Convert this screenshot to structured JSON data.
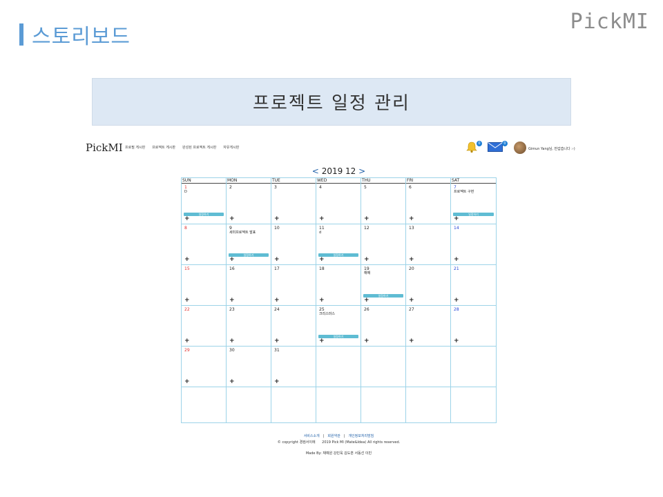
{
  "slide": {
    "title": "스토리보드",
    "logo": "PickMI",
    "subtitle": "프로젝트 일정 관리",
    "accent_color": "#5b9bd5"
  },
  "app": {
    "logo": "PickMI",
    "nav": [
      "프로필 게시판",
      "프로젝트 게시판",
      "완성된 프로젝트 게시판",
      "자유게시판"
    ],
    "notifications": {
      "bell_count": "0",
      "mail_count": "0"
    },
    "greeting": "Gimun Yang님, 반갑습니다 :-)",
    "icons": {
      "bell": "bell-icon",
      "mail": "mail-icon",
      "avatar": "avatar"
    }
  },
  "calendar": {
    "prev": "<",
    "title": "2019 12",
    "next": ">",
    "weekdays": [
      "SUN",
      "MON",
      "TUE",
      "WED",
      "THU",
      "FRI",
      "SAT"
    ],
    "event_button_label": "일정하기",
    "add_symbol": "+",
    "weeks": [
      [
        {
          "day": "1",
          "event": "D",
          "button": true,
          "add": true
        },
        {
          "day": "2",
          "event": "",
          "button": false,
          "add": true
        },
        {
          "day": "3",
          "event": "",
          "button": false,
          "add": true
        },
        {
          "day": "4",
          "event": "",
          "button": false,
          "add": true
        },
        {
          "day": "5",
          "event": "",
          "button": false,
          "add": true
        },
        {
          "day": "6",
          "event": "",
          "button": false,
          "add": true
        },
        {
          "day": "7",
          "event": "프로젝트 구현",
          "button": true,
          "add": true
        }
      ],
      [
        {
          "day": "8",
          "event": "",
          "button": false,
          "add": true
        },
        {
          "day": "9",
          "event": "세미프로젝트 발표",
          "button": true,
          "add": true
        },
        {
          "day": "10",
          "event": "",
          "button": false,
          "add": true
        },
        {
          "day": "11",
          "event": "d",
          "button": true,
          "add": true
        },
        {
          "day": "12",
          "event": "",
          "button": false,
          "add": true
        },
        {
          "day": "13",
          "event": "",
          "button": false,
          "add": true
        },
        {
          "day": "14",
          "event": "",
          "button": false,
          "add": true
        }
      ],
      [
        {
          "day": "15",
          "event": "",
          "button": false,
          "add": true
        },
        {
          "day": "16",
          "event": "",
          "button": false,
          "add": true
        },
        {
          "day": "17",
          "event": "",
          "button": false,
          "add": true
        },
        {
          "day": "18",
          "event": "",
          "button": false,
          "add": true
        },
        {
          "day": "19",
          "event": "해해",
          "button": true,
          "add": true
        },
        {
          "day": "20",
          "event": "",
          "button": false,
          "add": true
        },
        {
          "day": "21",
          "event": "",
          "button": false,
          "add": true
        }
      ],
      [
        {
          "day": "22",
          "event": "",
          "button": false,
          "add": true
        },
        {
          "day": "23",
          "event": "",
          "button": false,
          "add": true
        },
        {
          "day": "24",
          "event": "",
          "button": false,
          "add": true
        },
        {
          "day": "25",
          "event": "크리스마스",
          "button": true,
          "add": true
        },
        {
          "day": "26",
          "event": "",
          "button": false,
          "add": true
        },
        {
          "day": "27",
          "event": "",
          "button": false,
          "add": true
        },
        {
          "day": "28",
          "event": "",
          "button": false,
          "add": true
        }
      ],
      [
        {
          "day": "29",
          "event": "",
          "button": false,
          "add": true
        },
        {
          "day": "30",
          "event": "",
          "button": false,
          "add": true
        },
        {
          "day": "31",
          "event": "",
          "button": false,
          "add": true
        },
        {
          "day": "",
          "event": "",
          "button": false,
          "add": false
        },
        {
          "day": "",
          "event": "",
          "button": false,
          "add": false
        },
        {
          "day": "",
          "event": "",
          "button": false,
          "add": false
        },
        {
          "day": "",
          "event": "",
          "button": false,
          "add": false
        }
      ],
      [
        {
          "day": "",
          "event": "",
          "button": false,
          "add": false
        },
        {
          "day": "",
          "event": "",
          "button": false,
          "add": false
        },
        {
          "day": "",
          "event": "",
          "button": false,
          "add": false
        },
        {
          "day": "",
          "event": "",
          "button": false,
          "add": false
        },
        {
          "day": "",
          "event": "",
          "button": false,
          "add": false
        },
        {
          "day": "",
          "event": "",
          "button": false,
          "add": false
        },
        {
          "day": "",
          "event": "",
          "button": false,
          "add": false
        }
      ]
    ]
  },
  "footer": {
    "links": [
      "서비스소개",
      "회원약관",
      "개인정보처리방침"
    ],
    "copyright_left": "© copyright 경컴서이에",
    "copyright_right": "2019 Pick MI (Mate&Idea)  All rights reserved.",
    "made_by": "Made By: 채예원 강민욱 김도훈 서동선 이빈"
  }
}
